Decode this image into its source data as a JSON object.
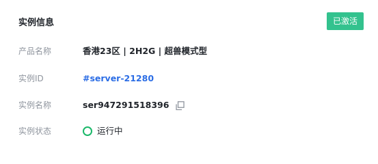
{
  "panel": {
    "title": "实例信息",
    "status_tag": "已激活"
  },
  "fields": [
    {
      "label": "产品名称",
      "value": "香港23区 | 2H2G | 超兽模式型"
    },
    {
      "label": "实例ID",
      "value": "#server-21280"
    },
    {
      "label": "实例名称",
      "value": "ser947291518396"
    },
    {
      "label": "实例状态",
      "value": "运行中"
    }
  ],
  "icons": {
    "copy": "copy-icon",
    "status": "running-status-icon"
  },
  "colors": {
    "accent_green": "#33c28e",
    "status_green": "#1ab869",
    "link_blue": "#2b6de5"
  }
}
